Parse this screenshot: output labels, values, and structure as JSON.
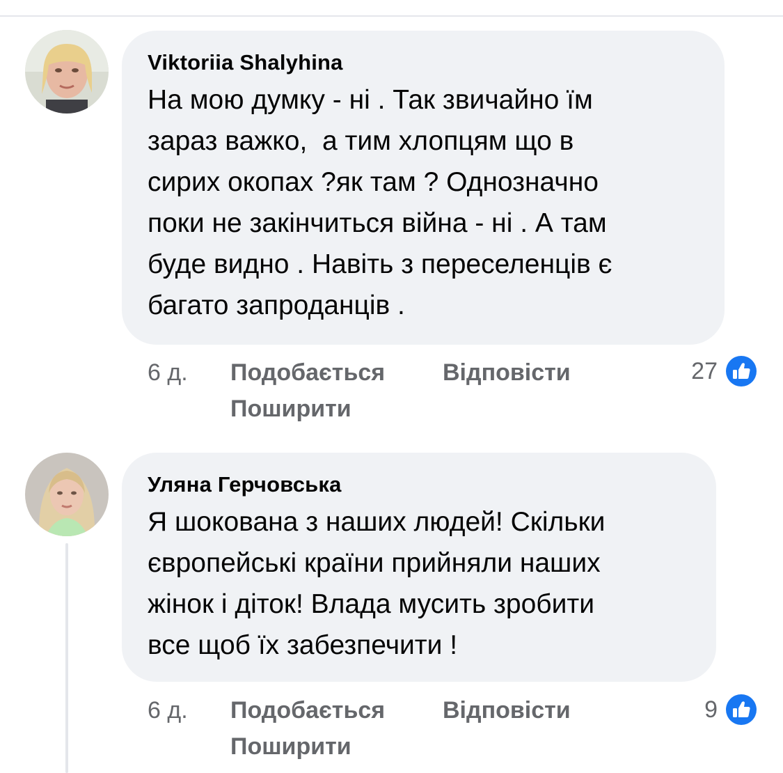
{
  "comments": [
    {
      "author": "Viktoriia Shalyhina",
      "text": "На мою думку - ні . Так звичайно їм\nзараз важко,  а тим хлопцям що в\nсирих окопах ?як там ? Однозначно\nпоки не закінчиться війна - ні . А там\nбуде видно . Навіть з переселенців є\nбагато запроданців .",
      "time": "6 д.",
      "like_label": "Подобається",
      "reply_label": "Відповісти",
      "share_label": "Поширити",
      "reaction_count": "27",
      "reaction_icon": "like-thumbs-up-icon"
    },
    {
      "author": "Уляна Герчовська",
      "text": "Я шокована з наших людей! Скільки\nєвропейські країни прийняли наших\nжінок і діток! Влада мусить зробити\nвсе щоб їх забезпечити !",
      "time": "6 д.",
      "like_label": "Подобається",
      "reply_label": "Відповісти",
      "share_label": "Поширити",
      "reaction_count": "9",
      "reaction_icon": "like-thumbs-up-icon"
    }
  ],
  "colors": {
    "bubble_background": "#f0f2f5",
    "secondary_text": "#65676b",
    "like_blue": "#1877f2"
  }
}
